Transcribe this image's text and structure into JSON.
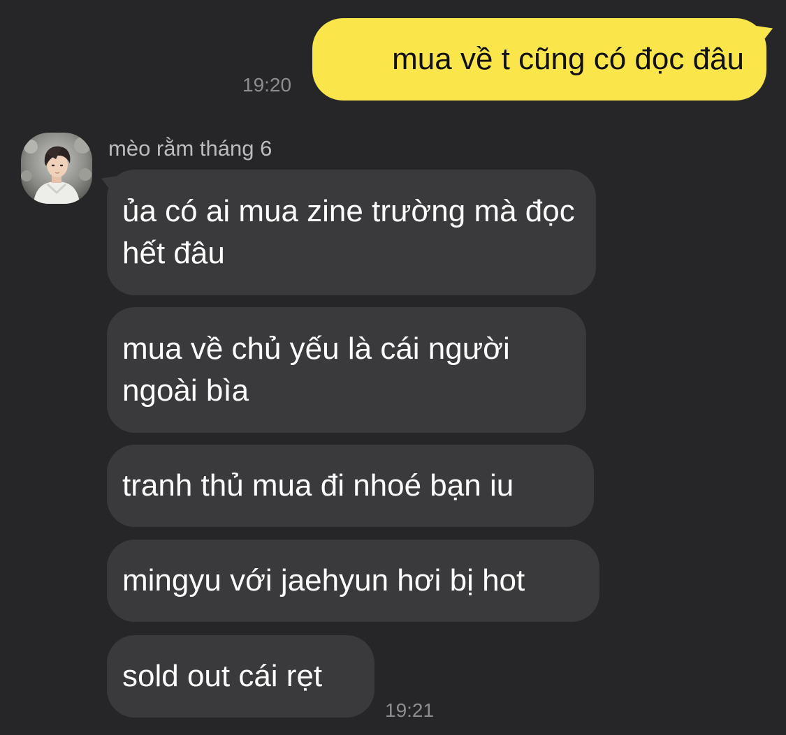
{
  "conversation": {
    "outgoing": [
      {
        "text": "mua về t cũng có đọc đâu",
        "time": "19:20"
      }
    ],
    "incoming_group": {
      "sender_name": "mèo rằm tháng 6",
      "avatar_icon": "user-avatar-photo",
      "messages": [
        {
          "text": "ủa có ai mua zine trường mà đọc hết đâu"
        },
        {
          "text": "mua về chủ yếu là cái người ngoài bìa"
        },
        {
          "text": "tranh thủ mua đi nhoé bạn iu"
        },
        {
          "text": "mingyu với jaehyun hơi bị hot"
        },
        {
          "text": "sold out cái rẹt"
        }
      ],
      "time": "19:21"
    }
  },
  "colors": {
    "background": "#262628",
    "outgoing_bubble": "#fae54b",
    "incoming_bubble": "#3a3a3c",
    "timestamp": "#8d8d90",
    "sender_name": "#bcbcc0"
  }
}
